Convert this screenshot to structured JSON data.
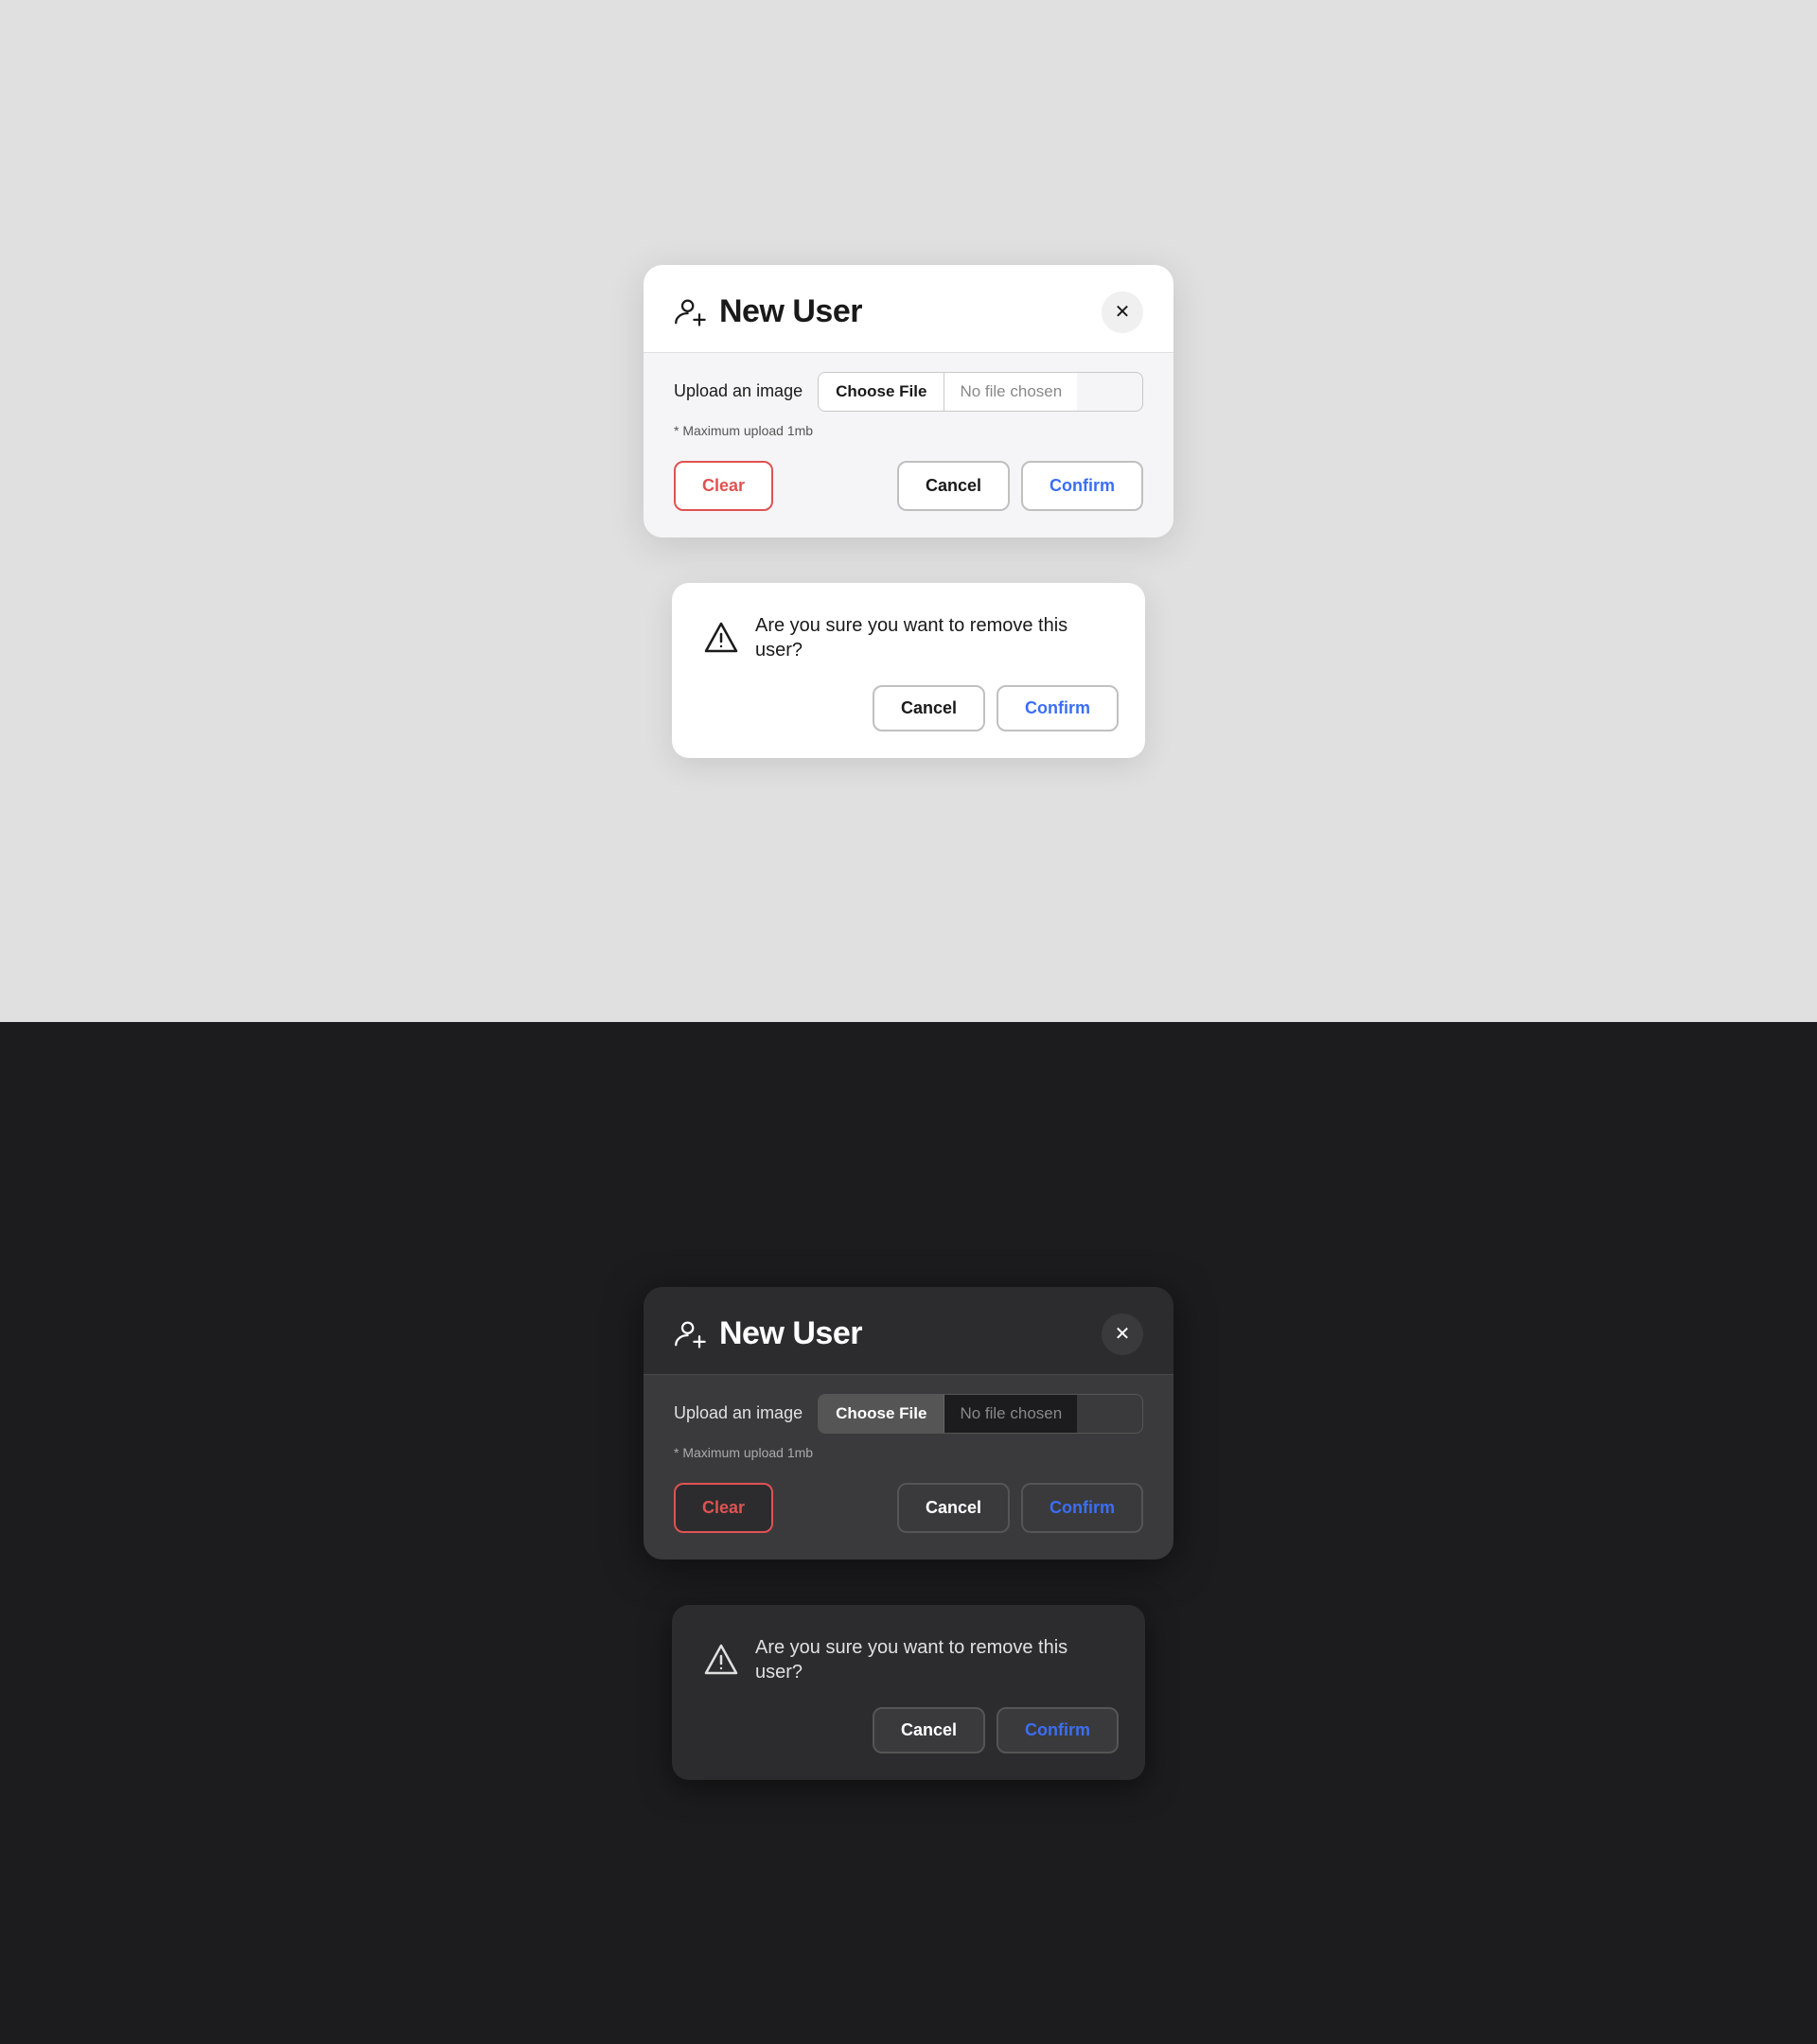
{
  "themes": [
    "light",
    "dark"
  ],
  "modal": {
    "title": "New User",
    "close_label": "✕",
    "upload_label": "Upload an image",
    "choose_file_label": "Choose File",
    "no_file_label": "No file chosen",
    "max_upload_note": "* Maximum upload 1mb",
    "clear_label": "Clear",
    "cancel_label": "Cancel",
    "confirm_label": "Confirm"
  },
  "confirm_dialog": {
    "message": "Are you sure you want to remove this user?",
    "cancel_label": "Cancel",
    "confirm_label": "Confirm",
    "warning_icon": "⚠"
  },
  "icons": {
    "user_add": "user-add",
    "close": "close",
    "warning": "warning"
  }
}
